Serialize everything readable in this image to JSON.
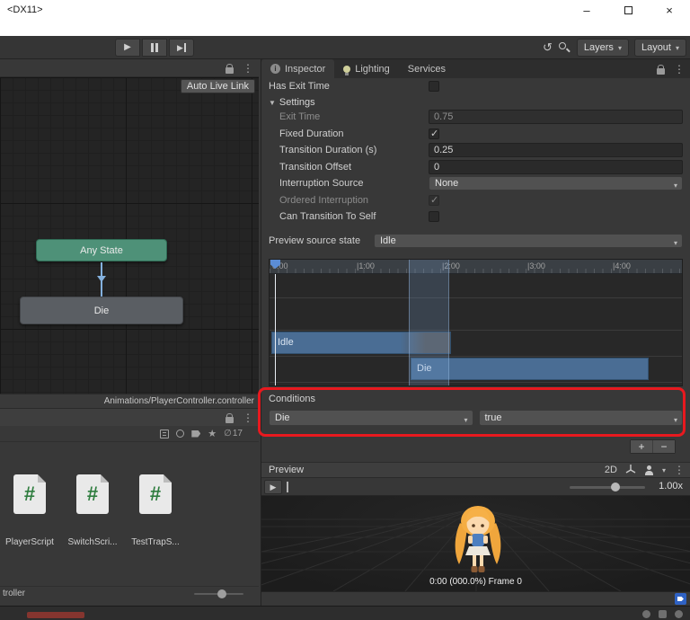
{
  "window": {
    "title": "<DX11>"
  },
  "icons": {
    "minimize": "–",
    "close": "×",
    "play": "▶",
    "caret_down": "▾",
    "kebab": "⋮",
    "history": "↺",
    "foldout": "▼",
    "check": "✓",
    "hidden": "∅",
    "star": "★"
  },
  "toolbar": {
    "layers": "Layers",
    "layout": "Layout"
  },
  "animator": {
    "auto_live_link": "Auto Live Link",
    "any_state": "Any State",
    "die_state": "Die",
    "footer": "Animations/PlayerController.controller"
  },
  "project": {
    "hidden_count": "17",
    "script_glyph": "#",
    "items": [
      "PlayerScript",
      "SwitchScri...",
      "TestTrapS..."
    ],
    "footer": "troller"
  },
  "inspector": {
    "tabs": {
      "inspector": "Inspector",
      "lighting": "Lighting",
      "services": "Services"
    },
    "has_exit_time": {
      "label": "Has Exit Time",
      "checked": false
    },
    "settings": {
      "label": "Settings",
      "fields": [
        {
          "label": "Exit Time",
          "value": "0.75",
          "disabled": true
        },
        {
          "label": "Fixed Duration",
          "checked": true
        },
        {
          "label": "Transition Duration (s)",
          "value": "0.25"
        },
        {
          "label": "Transition Offset",
          "value": "0"
        },
        {
          "label": "Interruption Source",
          "value": "None"
        },
        {
          "label": "Ordered Interruption",
          "checked": true,
          "disabled": true
        },
        {
          "label": "Can Transition To Self",
          "checked": false
        }
      ]
    },
    "preview_source": {
      "label": "Preview source state",
      "value": "Idle"
    },
    "timeline": {
      "ticks": [
        "0:00",
        "|1:00",
        "|2:00",
        "|3:00",
        "|4:00"
      ],
      "bar_idle": "Idle",
      "bar_die": "Die"
    },
    "conditions": {
      "title": "Conditions",
      "param": "Die",
      "value": "true",
      "add": "+",
      "remove": "−"
    },
    "preview": {
      "title": "Preview",
      "mode2d": "2D",
      "speed": "1.00x",
      "frame_info": "0:00 (000.0%) Frame 0"
    }
  }
}
